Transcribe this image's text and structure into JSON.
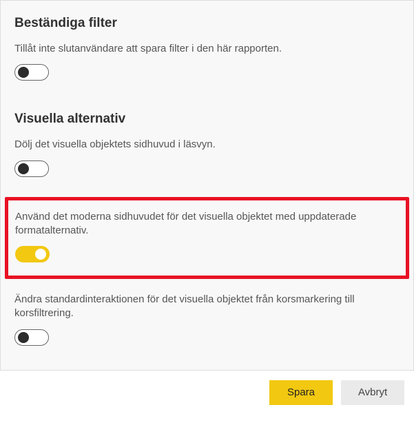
{
  "sections": {
    "persistent_filters": {
      "heading": "Beständiga filter",
      "option1": {
        "text": "Tillåt inte slutanvändare att spara filter i den här rapporten.",
        "on": false
      }
    },
    "visual_options": {
      "heading": "Visuella alternativ",
      "option1": {
        "text": "Dölj det visuella objektets sidhuvud i läsvyn.",
        "on": false
      },
      "option2": {
        "text": "Använd det moderna sidhuvudet för det visuella objektet med uppdaterade formatalternativ.",
        "on": true
      },
      "option3": {
        "text": "Ändra standardinteraktionen för det visuella objektet från korsmarkering till korsfiltrering.",
        "on": false
      }
    }
  },
  "buttons": {
    "save": "Spara",
    "cancel": "Avbryt"
  },
  "colors": {
    "accent": "#f2c811",
    "highlight_border": "#e81123"
  }
}
